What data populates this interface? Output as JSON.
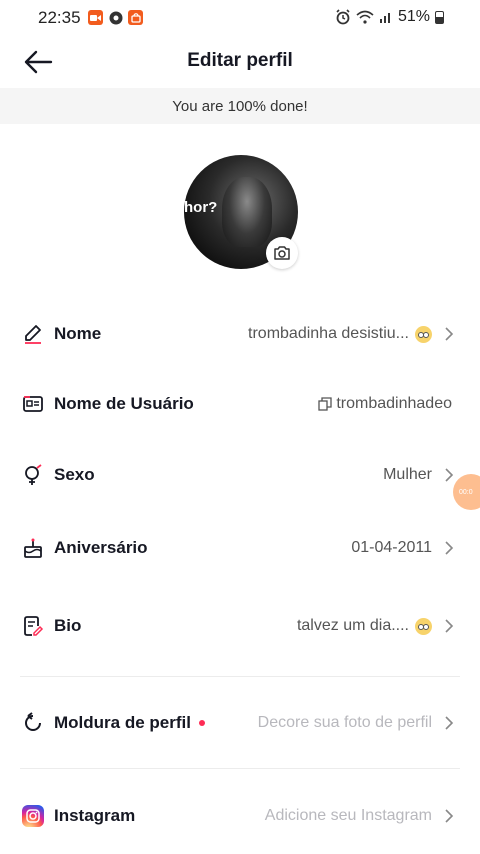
{
  "status_bar": {
    "time": "22:35",
    "battery": "51%"
  },
  "header": {
    "title": "Editar perfil"
  },
  "banner": {
    "text": "You are 100% done!"
  },
  "avatar": {
    "overlay_text": "hor?"
  },
  "rows": {
    "nome": {
      "label": "Nome",
      "value": "trombadinha desistiu..."
    },
    "usuario": {
      "label": "Nome de Usuário",
      "value": "trombadinhadeo"
    },
    "sexo": {
      "label": "Sexo",
      "value": "Mulher"
    },
    "aniversario": {
      "label": "Aniversário",
      "value": "01-04-2011"
    },
    "bio": {
      "label": "Bio",
      "value": "talvez um dia...."
    },
    "moldura": {
      "label": "Moldura de perfil",
      "value": "Decore sua foto de perfil"
    },
    "instagram": {
      "label": "Instagram",
      "value": "Adicione seu Instagram"
    }
  },
  "floating_bubble": {
    "text": "00:0"
  },
  "colors": {
    "accent_red": "#fe2c55",
    "banner_bg": "#f5f5f5",
    "text_primary": "#161823",
    "placeholder": "#b8b8bd"
  }
}
